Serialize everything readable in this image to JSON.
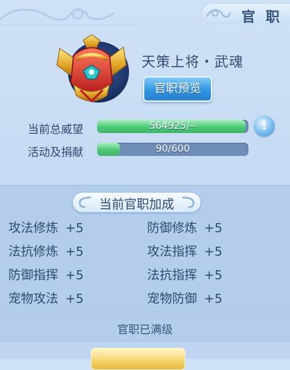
{
  "header": {
    "title": "官 职"
  },
  "rank": {
    "name": "天策上将・武魂",
    "preview_label": "官职预览"
  },
  "stats": [
    {
      "label": "当前总威望",
      "value_text": "564925/--",
      "fill_fraction": 0.98
    },
    {
      "label": "活动及捐献",
      "value_text": "90/600",
      "fill_fraction": 0.15
    }
  ],
  "info_button_glyph": "!",
  "bonus_section": {
    "title": "当前官职加成",
    "items": [
      {
        "name": "攻法修炼",
        "value": "+5"
      },
      {
        "name": "防御修炼",
        "value": "+5"
      },
      {
        "name": "法抗修炼",
        "value": "+5"
      },
      {
        "name": "攻法指挥",
        "value": "+5"
      },
      {
        "name": "防御指挥",
        "value": "+5"
      },
      {
        "name": "法抗指挥",
        "value": "+5"
      },
      {
        "name": "宠物攻法",
        "value": "+5"
      },
      {
        "name": "宠物防御",
        "value": "+5"
      }
    ],
    "status": "官职已满级"
  },
  "colors": {
    "accent_green": "#4cc978",
    "button_blue": "#2f92e0",
    "text_dark": "#2f4a72",
    "gold": "#e6b83f"
  },
  "icons": {
    "portrait": "golden-helmet-icon",
    "info": "exclamation-icon",
    "bottom": "gold-button"
  }
}
